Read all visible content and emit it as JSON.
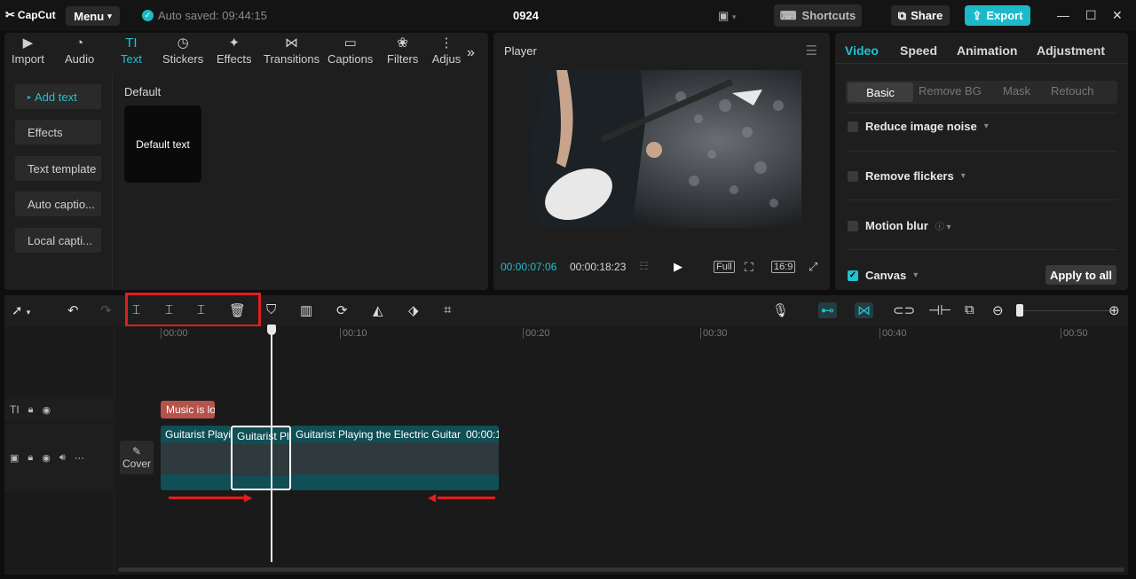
{
  "app": {
    "logo": "CapCut",
    "menu_label": "Menu",
    "autosave": "Auto saved: 09:44:15",
    "project_title": "0924",
    "shortcuts_label": "Shortcuts",
    "share_label": "Share",
    "export_label": "Export"
  },
  "media_tabs": [
    "Import",
    "Audio",
    "Text",
    "Stickers",
    "Effects",
    "Transitions",
    "Captions",
    "Filters",
    "Adjus"
  ],
  "text_sidebar": [
    "Add text",
    "Effects",
    "Text template",
    "Auto captio...",
    "Local capti..."
  ],
  "text_panel": {
    "section_title": "Default",
    "card_label": "Default text"
  },
  "player": {
    "title": "Player",
    "current_time": "00:00:07:06",
    "total_time": "00:00:18:23",
    "full_label": "Full",
    "ratio_label": "16:9"
  },
  "props": {
    "tabs": [
      "Video",
      "Speed",
      "Animation",
      "Adjustment"
    ],
    "subtabs": [
      "Basic",
      "Remove BG",
      "Mask",
      "Retouch"
    ],
    "options": [
      "Reduce image noise",
      "Remove flickers",
      "Motion blur",
      "Canvas"
    ],
    "apply_all_label": "Apply to all"
  },
  "timeline": {
    "ruler": [
      "00:00",
      "00:10",
      "00:20",
      "00:30",
      "00:40",
      "00:50"
    ],
    "text_clip": "Music is lo",
    "clips": [
      "Guitarist Playi",
      "Guitarist Pl",
      "Guitarist Playing the Electric Guitar"
    ],
    "clip_duration": "00:00:1",
    "cover_label": "Cover"
  },
  "colors": {
    "accent": "#1fc2d0",
    "highlight": "#e01e1e",
    "clip": "#0f4f55",
    "text_clip": "#b5524a"
  }
}
